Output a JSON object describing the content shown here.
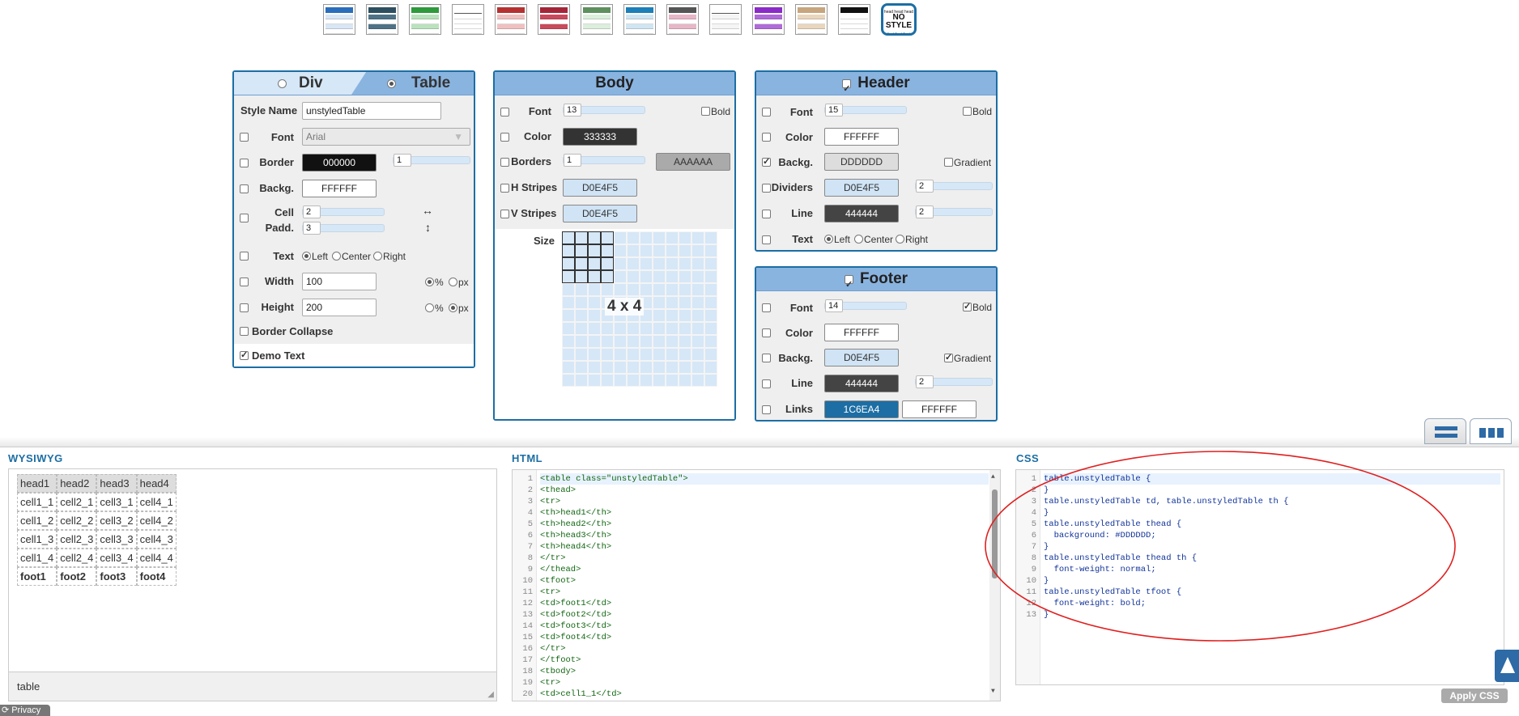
{
  "themes": [
    {
      "name": "theme-blue-icon",
      "head": "#2a6ebb",
      "row": "#d9e6f5"
    },
    {
      "name": "theme-dark-teal-icon",
      "head": "#2d4f5f",
      "row": "#4f7386"
    },
    {
      "name": "theme-green-icon",
      "head": "#2e9a3c",
      "row": "#b9e2bd"
    },
    {
      "name": "theme-minimal-icon",
      "head": "#ffffff",
      "row": "#ffffff"
    },
    {
      "name": "theme-red-icon",
      "head": "#b53131",
      "row": "#f0c0c0"
    },
    {
      "name": "theme-crimson-icon",
      "head": "#a32638",
      "row": "#c94a5c"
    },
    {
      "name": "theme-light-green-icon",
      "head": "#5e8f5e",
      "row": "#dceedc"
    },
    {
      "name": "theme-cyan-icon",
      "head": "#1c7fb8",
      "row": "#cfe6f2"
    },
    {
      "name": "theme-pink-icon",
      "head": "#555555",
      "row": "#e7b6c7"
    },
    {
      "name": "theme-plain-icon",
      "head": "#ffffff",
      "row": "#f5f5f5"
    },
    {
      "name": "theme-purple-icon",
      "head": "#8a2bc7",
      "row": "#b06ad9"
    },
    {
      "name": "theme-tan-icon",
      "head": "#c7a57f",
      "row": "#e9d6bd"
    },
    {
      "name": "theme-black-icon",
      "head": "#111111",
      "row": "#ffffff"
    }
  ],
  "nostyle_theme": {
    "line1": "head head head",
    "line2": "NO",
    "line3": "STYLE",
    "line4": "foot foot foot"
  },
  "general_panel": {
    "tab_div": "Div",
    "tab_table": "Table",
    "style_name_label": "Style Name",
    "style_name_value": "unstyledTable",
    "font_label": "Font",
    "font_value": "Arial",
    "border_label": "Border",
    "border_color": "000000",
    "border_width": "1",
    "backg_label": "Backg.",
    "backg_color": "FFFFFF",
    "cell_label": "Cell",
    "padd_label": "Padd.",
    "cell_h": "2",
    "cell_v": "3",
    "text_label": "Text",
    "text_left": "Left",
    "text_center": "Center",
    "text_right": "Right",
    "width_label": "Width",
    "width_value": "100",
    "percent": "%",
    "px": "px",
    "height_label": "Height",
    "height_value": "200",
    "border_collapse_label": "Border Collapse",
    "demo_text_label": "Demo Text"
  },
  "body_panel": {
    "title": "Body",
    "font_label": "Font",
    "font_size": "13",
    "bold_label": "Bold",
    "color_label": "Color",
    "color_value": "333333",
    "borders_label": "Borders",
    "borders_width": "1",
    "borders_color": "AAAAAA",
    "hstripes_label": "H Stripes",
    "hstripes_color": "D0E4F5",
    "vstripes_label": "V Stripes",
    "vstripes_color": "D0E4F5",
    "size_label": "Size",
    "size_value": "4 x 4"
  },
  "header_panel": {
    "title": "Header",
    "font_label": "Font",
    "font_size": "15",
    "bold_label": "Bold",
    "color_label": "Color",
    "color_value": "FFFFFF",
    "backg_label": "Backg.",
    "backg_value": "DDDDDD",
    "gradient_label": "Gradient",
    "dividers_label": "Dividers",
    "dividers_color": "D0E4F5",
    "dividers_width": "2",
    "line_label": "Line",
    "line_color": "444444",
    "line_width": "2",
    "text_label": "Text",
    "text_left": "Left",
    "text_center": "Center",
    "text_right": "Right"
  },
  "footer_panel": {
    "title": "Footer",
    "font_label": "Font",
    "font_size": "14",
    "bold_label": "Bold",
    "color_label": "Color",
    "color_value": "FFFFFF",
    "backg_label": "Backg.",
    "backg_value": "D0E4F5",
    "gradient_label": "Gradient",
    "line_label": "Line",
    "line_color": "444444",
    "line_width": "2",
    "links_label": "Links",
    "links_color1": "1C6EA4",
    "links_color2": "FFFFFF"
  },
  "wysiwyg": {
    "title": "WYSIWYG",
    "head": [
      "head1",
      "head2",
      "head3",
      "head4"
    ],
    "rows": [
      [
        "cell1_1",
        "cell2_1",
        "cell3_1",
        "cell4_1"
      ],
      [
        "cell1_2",
        "cell2_2",
        "cell3_2",
        "cell4_2"
      ],
      [
        "cell1_3",
        "cell2_3",
        "cell3_3",
        "cell4_3"
      ],
      [
        "cell1_4",
        "cell2_4",
        "cell3_4",
        "cell4_4"
      ]
    ],
    "foot": [
      "foot1",
      "foot2",
      "foot3",
      "foot4"
    ],
    "status": "table"
  },
  "html_editor": {
    "title": "HTML",
    "line_numbers": [
      "1",
      "2",
      "3",
      "4",
      "5",
      "6",
      "7",
      "8",
      "9",
      "10",
      "11",
      "12",
      "13",
      "14",
      "15",
      "16",
      "17",
      "18",
      "19",
      "20"
    ],
    "lines": [
      "<table class=\"unstyledTable\">",
      "<thead>",
      "<tr>",
      "<th>head1</th>",
      "<th>head2</th>",
      "<th>head3</th>",
      "<th>head4</th>",
      "</tr>",
      "</thead>",
      "<tfoot>",
      "<tr>",
      "<td>foot1</td>",
      "<td>foot2</td>",
      "<td>foot3</td>",
      "<td>foot4</td>",
      "</tr>",
      "</tfoot>",
      "<tbody>",
      "<tr>",
      "<td>cell1_1</td>"
    ]
  },
  "css_editor": {
    "title": "CSS",
    "line_numbers": [
      "1",
      "2",
      "3",
      "4",
      "5",
      "6",
      "7",
      "8",
      "9",
      "10",
      "11",
      "12",
      "13"
    ],
    "lines": [
      "table.unstyledTable {",
      "}",
      "table.unstyledTable td, table.unstyledTable th {",
      "}",
      "table.unstyledTable thead {",
      "  background: #DDDDDD;",
      "}",
      "table.unstyledTable thead th {",
      "  font-weight: normal;",
      "}",
      "table.unstyledTable tfoot {",
      "  font-weight: bold;",
      "}"
    ],
    "apply_label": "Apply CSS"
  },
  "privacy_label": "Privacy"
}
